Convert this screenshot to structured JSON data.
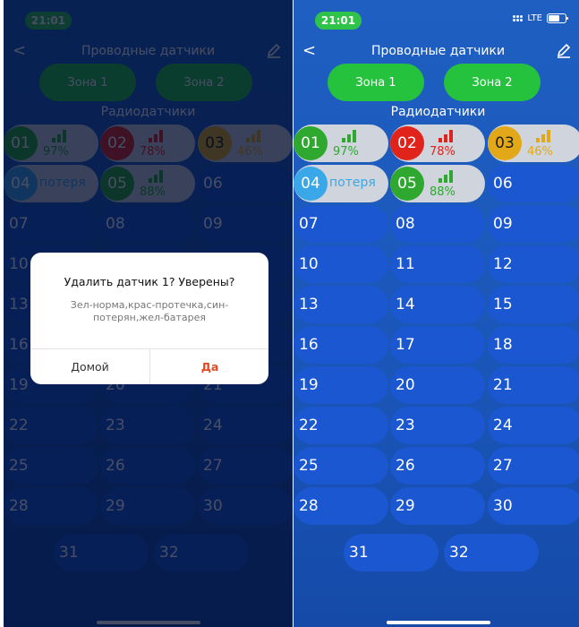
{
  "status": {
    "time": "21:01",
    "network": "LTE"
  },
  "nav": {
    "back": "<",
    "title": "Проводные датчики"
  },
  "zones": [
    "Зона 1",
    "Зона 2"
  ],
  "radio_title": "Радиодатчики",
  "sensors": [
    {
      "num": "01",
      "state": "ok",
      "pct": "97%"
    },
    {
      "num": "02",
      "state": "leak",
      "pct": "78%"
    },
    {
      "num": "03",
      "state": "battery",
      "pct": "46%"
    },
    {
      "num": "04",
      "state": "lost",
      "label": "потеря"
    },
    {
      "num": "05",
      "state": "ok",
      "pct": "88%"
    },
    {
      "num": "06"
    },
    {
      "num": "07"
    },
    {
      "num": "08"
    },
    {
      "num": "09"
    },
    {
      "num": "10"
    },
    {
      "num": "11"
    },
    {
      "num": "12"
    },
    {
      "num": "13"
    },
    {
      "num": "14"
    },
    {
      "num": "15"
    },
    {
      "num": "16"
    },
    {
      "num": "17"
    },
    {
      "num": "18"
    },
    {
      "num": "19"
    },
    {
      "num": "20"
    },
    {
      "num": "21"
    },
    {
      "num": "22"
    },
    {
      "num": "23"
    },
    {
      "num": "24"
    },
    {
      "num": "25"
    },
    {
      "num": "26"
    },
    {
      "num": "27"
    },
    {
      "num": "28"
    },
    {
      "num": "29"
    },
    {
      "num": "30"
    },
    {
      "num": "31"
    },
    {
      "num": "32"
    }
  ],
  "colors": {
    "ok": "#2ea82e",
    "leak": "#e0241c",
    "battery": "#e3a817",
    "lost": "#3aa7e8",
    "green": "#25c23d"
  },
  "dialog": {
    "title": "Удалить датчик 1? Уверены?",
    "message": "Зел-норма,крас-протечка,син-потерян,жел-батарея",
    "cancel": "Домой",
    "ok": "Да"
  }
}
